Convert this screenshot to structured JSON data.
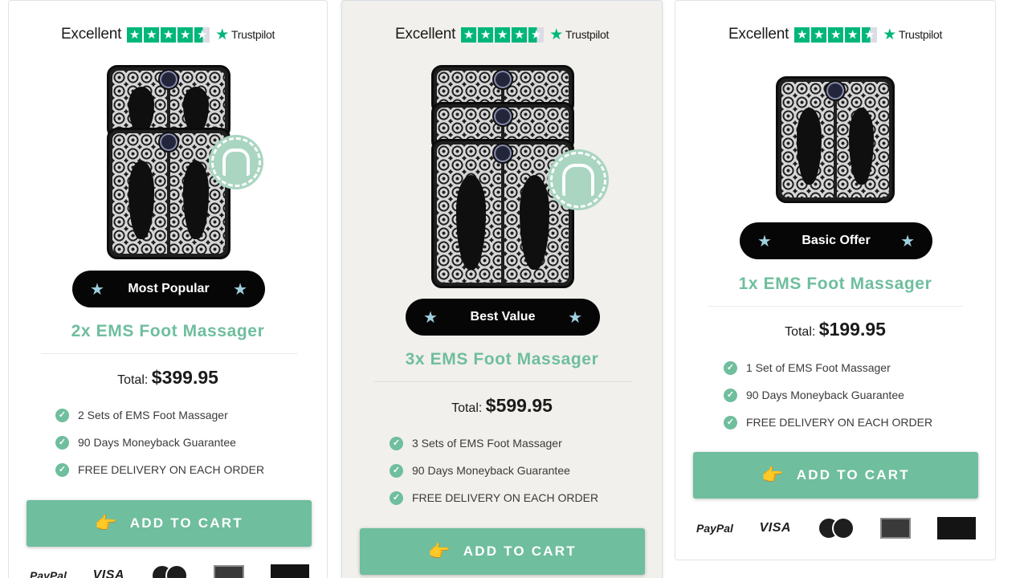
{
  "trustpilot": {
    "rating_label": "Excellent",
    "star_glyph": "★",
    "brand": "Trustpilot",
    "stars": 4.5
  },
  "products": [
    {
      "badge": "Most Popular",
      "title": "2x EMS Foot Massager",
      "total_label": "Total:",
      "price": "$399.95",
      "features": [
        "2 Sets of EMS Foot Massager",
        "90 Days Moneyback Guarantee",
        "FREE DELIVERY ON EACH ORDER"
      ],
      "cta": "ADD TO CART"
    },
    {
      "badge": "Best Value",
      "title": "3x EMS Foot Massager",
      "total_label": "Total:",
      "price": "$599.95",
      "features": [
        "3 Sets of EMS Foot Massager",
        "90 Days Moneyback Guarantee",
        "FREE DELIVERY ON EACH ORDER"
      ],
      "cta": "ADD TO CART"
    },
    {
      "badge": "Basic Offer",
      "title": "1x EMS Foot Massager",
      "total_label": "Total:",
      "price": "$199.95",
      "features": [
        "1 Set of EMS Foot Massager",
        "90 Days Moneyback Guarantee",
        "FREE DELIVERY ON EACH ORDER"
      ],
      "cta": "ADD TO CART"
    }
  ],
  "payments": {
    "paypal": "PayPal",
    "visa": "VISA"
  },
  "icons": {
    "badge_star": "★",
    "check": "✓",
    "pointing_hand": "👉"
  },
  "colors": {
    "accent": "#6fbe9e",
    "trustpilot": "#00b67a",
    "pill": "#060606",
    "badge_star": "#9fd0df",
    "featured_bg": "#f2f0ec"
  }
}
